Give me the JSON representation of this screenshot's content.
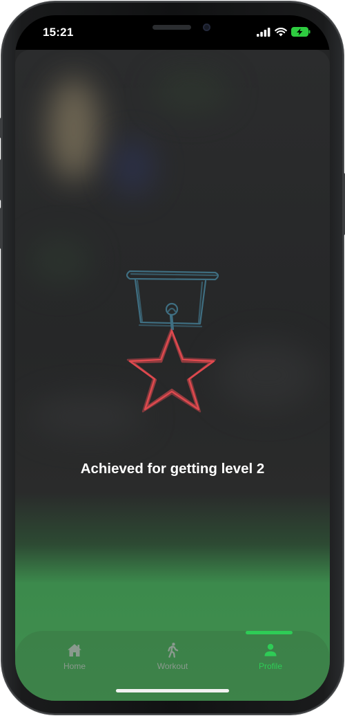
{
  "status_bar": {
    "time": "15:21",
    "signal_icon": "signal-bars-icon",
    "wifi_icon": "wifi-icon",
    "battery_icon": "battery-charging-icon"
  },
  "achievement": {
    "icon": "star-medal-icon",
    "caption": "Achieved for getting level 2",
    "ribbon_color": "#3f6f82",
    "star_color": "#e04a4f"
  },
  "tab_bar": {
    "active_color": "#2ecc56",
    "inactive_color": "#8a9a8e",
    "tabs": [
      {
        "label": "Home",
        "icon": "house-icon",
        "active": false
      },
      {
        "label": "Workout",
        "icon": "walking-person-icon",
        "active": false
      },
      {
        "label": "Profile",
        "icon": "person-icon",
        "active": true
      }
    ]
  }
}
